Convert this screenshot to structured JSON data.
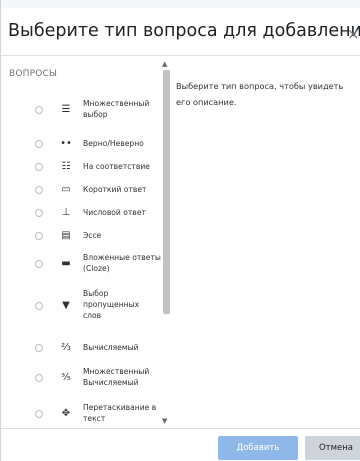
{
  "dialog": {
    "title": "Выберите тип вопроса для добавления",
    "close_glyph": "×"
  },
  "left_panel": {
    "section_label": "ВОПРОСЫ",
    "items": [
      {
        "label": "Множественный выбор",
        "icon": "list-bullets-icon",
        "glyph": "☰"
      },
      {
        "label": "Верно/Неверно",
        "icon": "two-dots-icon",
        "glyph": "••"
      },
      {
        "label": "На соответствие",
        "icon": "grid-match-icon",
        "glyph": "☷"
      },
      {
        "label": "Короткий ответ",
        "icon": "short-answer-box-icon",
        "glyph": "▭"
      },
      {
        "label": "Числовой ответ",
        "icon": "numeric-icon",
        "glyph": "⊥"
      },
      {
        "label": "Эссе",
        "icon": "essay-page-icon",
        "glyph": "▤"
      },
      {
        "label": "Вложенные ответы (Cloze)",
        "icon": "cloze-icon",
        "glyph": "▬"
      },
      {
        "label": "Выбор пропущенных слов",
        "icon": "dropdown-arrow-icon",
        "glyph": "▼"
      },
      {
        "label": "Вычисляемый",
        "icon": "calculated-icon",
        "glyph": "⅔"
      },
      {
        "label": "Множественный Вычисляемый",
        "icon": "multi-calculated-icon",
        "glyph": "⅗"
      },
      {
        "label": "Перетаскивание в текст",
        "icon": "drag-move-icon",
        "glyph": "✥"
      }
    ]
  },
  "right_panel": {
    "description": "Выберите тип вопроса, чтобы увидеть его описание."
  },
  "footer": {
    "add_label": "Добавить",
    "cancel_label": "Отмена"
  },
  "colors": {
    "primary_disabled": "#8fb8e8",
    "secondary": "#ced4da",
    "scroll_thumb": "#c2c2c2"
  }
}
